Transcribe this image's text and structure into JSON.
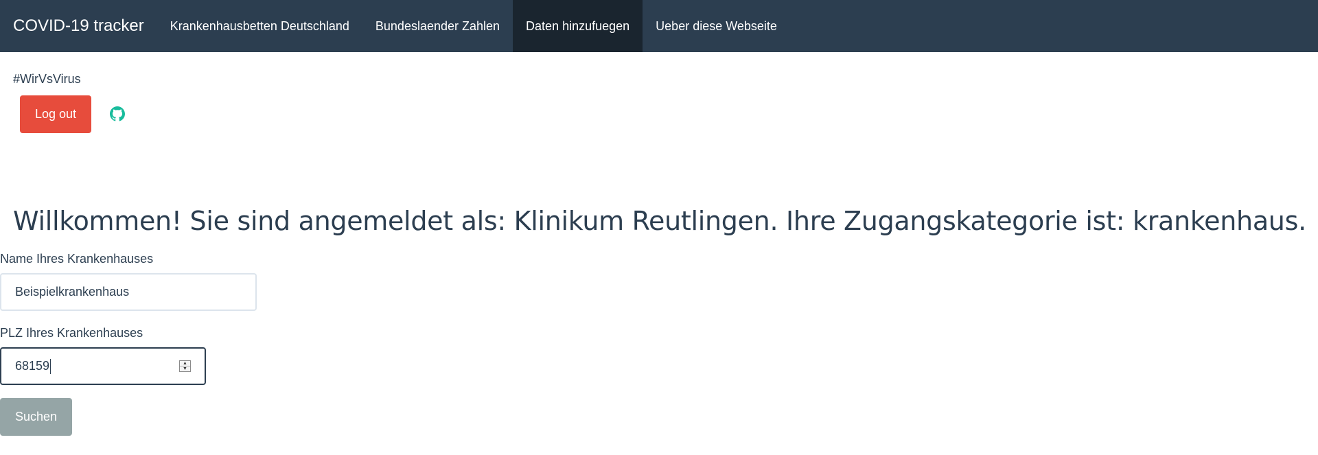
{
  "navbar": {
    "brand": "COVID-19 tracker",
    "items": [
      {
        "label": "Krankenhausbetten Deutschland",
        "active": false
      },
      {
        "label": "Bundeslaender Zahlen",
        "active": false
      },
      {
        "label": "Daten hinzufuegen",
        "active": true
      },
      {
        "label": "Ueber diese Webseite",
        "active": false
      }
    ]
  },
  "header": {
    "hashtag": "#WirVsVirus",
    "logout_label": "Log out",
    "github_icon": "github-icon"
  },
  "main": {
    "welcome": "Willkommen! Sie sind angemeldet als: Klinikum Reutlingen. Ihre Zugangskategorie ist: krankenhaus.",
    "name_label": "Name Ihres Krankenhauses",
    "name_value": "Beispielkrankenhaus",
    "plz_label": "PLZ Ihres Krankenhauses",
    "plz_value": "68159",
    "search_label": "Suchen"
  },
  "colors": {
    "navbar": "#2c3e50",
    "navbar_active": "#1a252f",
    "logout": "#e74c3c",
    "github": "#18bc9c",
    "search": "#95a5a6"
  }
}
